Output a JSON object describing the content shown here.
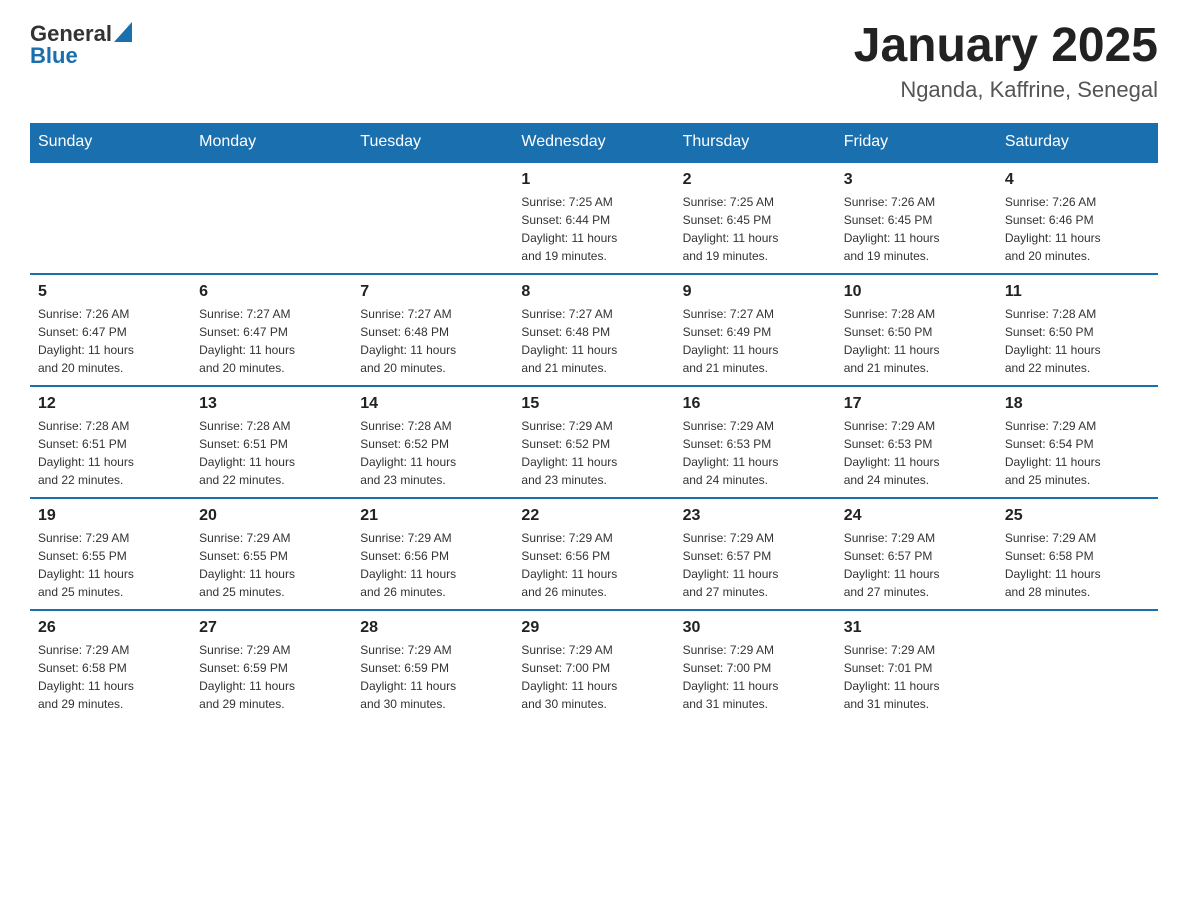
{
  "logo": {
    "general": "General",
    "blue": "Blue"
  },
  "header": {
    "title": "January 2025",
    "subtitle": "Nganda, Kaffrine, Senegal"
  },
  "weekdays": [
    "Sunday",
    "Monday",
    "Tuesday",
    "Wednesday",
    "Thursday",
    "Friday",
    "Saturday"
  ],
  "weeks": [
    [
      {
        "day": "",
        "info": ""
      },
      {
        "day": "",
        "info": ""
      },
      {
        "day": "",
        "info": ""
      },
      {
        "day": "1",
        "info": "Sunrise: 7:25 AM\nSunset: 6:44 PM\nDaylight: 11 hours\nand 19 minutes."
      },
      {
        "day": "2",
        "info": "Sunrise: 7:25 AM\nSunset: 6:45 PM\nDaylight: 11 hours\nand 19 minutes."
      },
      {
        "day": "3",
        "info": "Sunrise: 7:26 AM\nSunset: 6:45 PM\nDaylight: 11 hours\nand 19 minutes."
      },
      {
        "day": "4",
        "info": "Sunrise: 7:26 AM\nSunset: 6:46 PM\nDaylight: 11 hours\nand 20 minutes."
      }
    ],
    [
      {
        "day": "5",
        "info": "Sunrise: 7:26 AM\nSunset: 6:47 PM\nDaylight: 11 hours\nand 20 minutes."
      },
      {
        "day": "6",
        "info": "Sunrise: 7:27 AM\nSunset: 6:47 PM\nDaylight: 11 hours\nand 20 minutes."
      },
      {
        "day": "7",
        "info": "Sunrise: 7:27 AM\nSunset: 6:48 PM\nDaylight: 11 hours\nand 20 minutes."
      },
      {
        "day": "8",
        "info": "Sunrise: 7:27 AM\nSunset: 6:48 PM\nDaylight: 11 hours\nand 21 minutes."
      },
      {
        "day": "9",
        "info": "Sunrise: 7:27 AM\nSunset: 6:49 PM\nDaylight: 11 hours\nand 21 minutes."
      },
      {
        "day": "10",
        "info": "Sunrise: 7:28 AM\nSunset: 6:50 PM\nDaylight: 11 hours\nand 21 minutes."
      },
      {
        "day": "11",
        "info": "Sunrise: 7:28 AM\nSunset: 6:50 PM\nDaylight: 11 hours\nand 22 minutes."
      }
    ],
    [
      {
        "day": "12",
        "info": "Sunrise: 7:28 AM\nSunset: 6:51 PM\nDaylight: 11 hours\nand 22 minutes."
      },
      {
        "day": "13",
        "info": "Sunrise: 7:28 AM\nSunset: 6:51 PM\nDaylight: 11 hours\nand 22 minutes."
      },
      {
        "day": "14",
        "info": "Sunrise: 7:28 AM\nSunset: 6:52 PM\nDaylight: 11 hours\nand 23 minutes."
      },
      {
        "day": "15",
        "info": "Sunrise: 7:29 AM\nSunset: 6:52 PM\nDaylight: 11 hours\nand 23 minutes."
      },
      {
        "day": "16",
        "info": "Sunrise: 7:29 AM\nSunset: 6:53 PM\nDaylight: 11 hours\nand 24 minutes."
      },
      {
        "day": "17",
        "info": "Sunrise: 7:29 AM\nSunset: 6:53 PM\nDaylight: 11 hours\nand 24 minutes."
      },
      {
        "day": "18",
        "info": "Sunrise: 7:29 AM\nSunset: 6:54 PM\nDaylight: 11 hours\nand 25 minutes."
      }
    ],
    [
      {
        "day": "19",
        "info": "Sunrise: 7:29 AM\nSunset: 6:55 PM\nDaylight: 11 hours\nand 25 minutes."
      },
      {
        "day": "20",
        "info": "Sunrise: 7:29 AM\nSunset: 6:55 PM\nDaylight: 11 hours\nand 25 minutes."
      },
      {
        "day": "21",
        "info": "Sunrise: 7:29 AM\nSunset: 6:56 PM\nDaylight: 11 hours\nand 26 minutes."
      },
      {
        "day": "22",
        "info": "Sunrise: 7:29 AM\nSunset: 6:56 PM\nDaylight: 11 hours\nand 26 minutes."
      },
      {
        "day": "23",
        "info": "Sunrise: 7:29 AM\nSunset: 6:57 PM\nDaylight: 11 hours\nand 27 minutes."
      },
      {
        "day": "24",
        "info": "Sunrise: 7:29 AM\nSunset: 6:57 PM\nDaylight: 11 hours\nand 27 minutes."
      },
      {
        "day": "25",
        "info": "Sunrise: 7:29 AM\nSunset: 6:58 PM\nDaylight: 11 hours\nand 28 minutes."
      }
    ],
    [
      {
        "day": "26",
        "info": "Sunrise: 7:29 AM\nSunset: 6:58 PM\nDaylight: 11 hours\nand 29 minutes."
      },
      {
        "day": "27",
        "info": "Sunrise: 7:29 AM\nSunset: 6:59 PM\nDaylight: 11 hours\nand 29 minutes."
      },
      {
        "day": "28",
        "info": "Sunrise: 7:29 AM\nSunset: 6:59 PM\nDaylight: 11 hours\nand 30 minutes."
      },
      {
        "day": "29",
        "info": "Sunrise: 7:29 AM\nSunset: 7:00 PM\nDaylight: 11 hours\nand 30 minutes."
      },
      {
        "day": "30",
        "info": "Sunrise: 7:29 AM\nSunset: 7:00 PM\nDaylight: 11 hours\nand 31 minutes."
      },
      {
        "day": "31",
        "info": "Sunrise: 7:29 AM\nSunset: 7:01 PM\nDaylight: 11 hours\nand 31 minutes."
      },
      {
        "day": "",
        "info": ""
      }
    ]
  ]
}
